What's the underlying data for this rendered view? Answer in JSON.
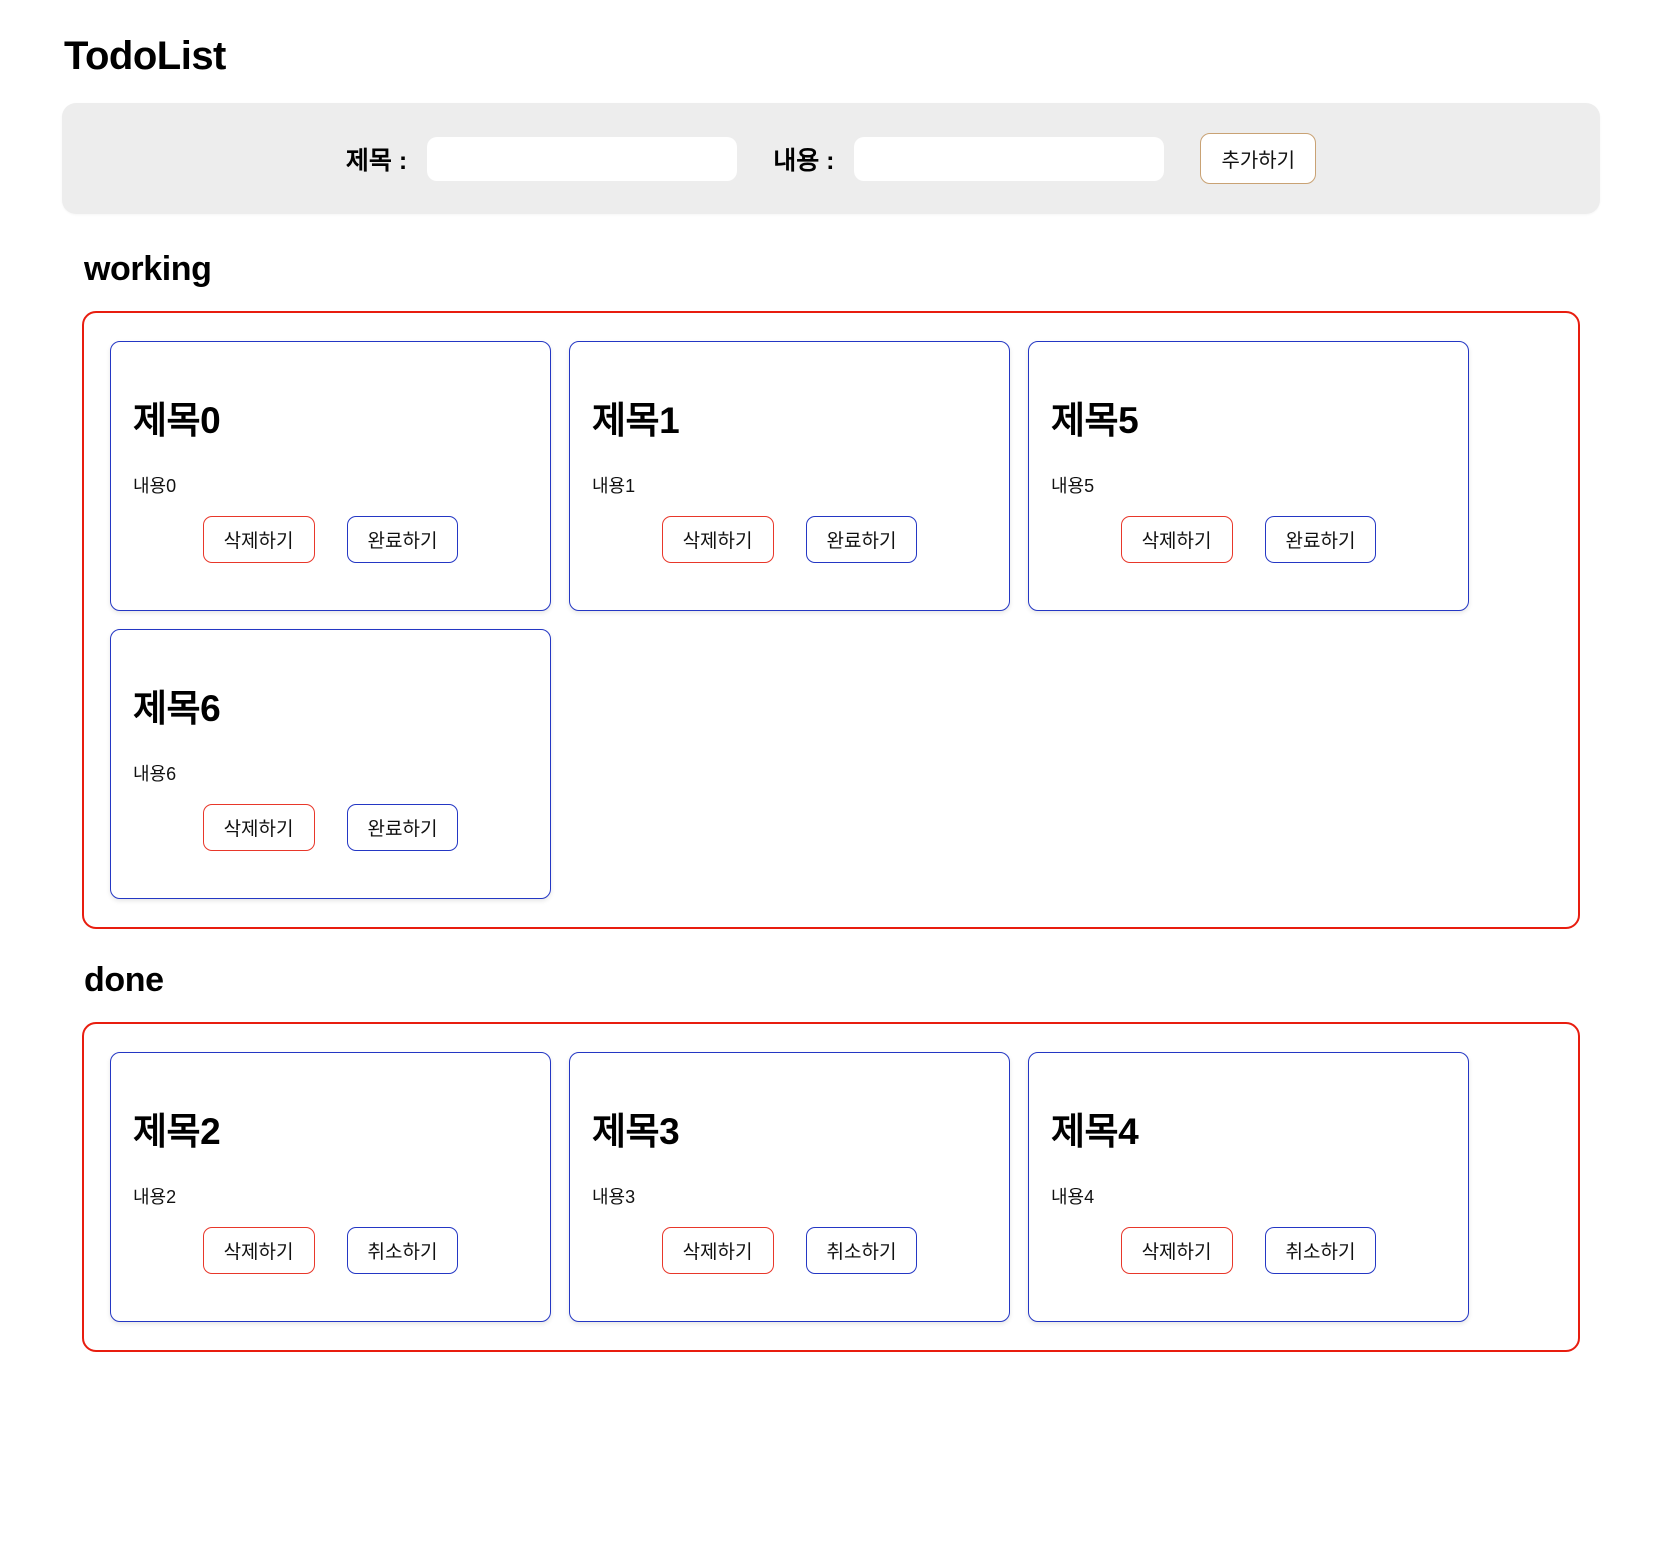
{
  "app": {
    "title": "TodoList"
  },
  "form": {
    "title_label": "제목 :",
    "title_value": "",
    "title_placeholder": "",
    "content_label": "내용 :",
    "content_value": "",
    "content_placeholder": "",
    "add_button_label": "추가하기"
  },
  "sections": [
    {
      "id": "working",
      "heading": "working",
      "items": [
        {
          "title": "제목0",
          "body": "내용0",
          "delete_label": "삭제하기",
          "action_label": "완료하기"
        },
        {
          "title": "제목1",
          "body": "내용1",
          "delete_label": "삭제하기",
          "action_label": "완료하기"
        },
        {
          "title": "제목5",
          "body": "내용5",
          "delete_label": "삭제하기",
          "action_label": "완료하기"
        },
        {
          "title": "제목6",
          "body": "내용6",
          "delete_label": "삭제하기",
          "action_label": "완료하기"
        }
      ]
    },
    {
      "id": "done",
      "heading": "done",
      "items": [
        {
          "title": "제목2",
          "body": "내용2",
          "delete_label": "삭제하기",
          "action_label": "취소하기"
        },
        {
          "title": "제목3",
          "body": "내용3",
          "delete_label": "삭제하기",
          "action_label": "취소하기"
        },
        {
          "title": "제목4",
          "body": "내용4",
          "delete_label": "삭제하기",
          "action_label": "취소하기"
        }
      ]
    }
  ],
  "colors": {
    "section_border": "#e81d0f",
    "card_border": "#2437c4",
    "delete_border": "#e8372a",
    "add_border": "#c9a274",
    "form_background": "#ededed"
  }
}
